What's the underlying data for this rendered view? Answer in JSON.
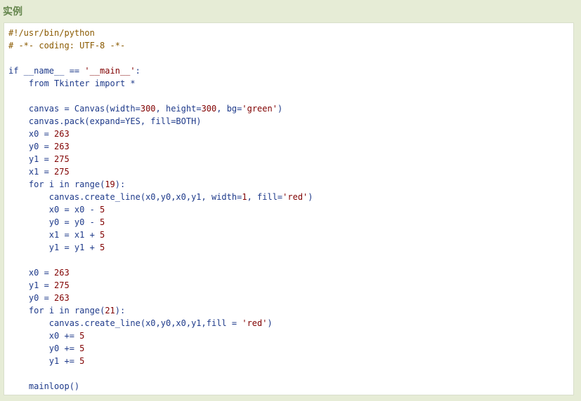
{
  "title": "实例",
  "colors": {
    "background": "#e6ecd6",
    "title": "#64854c",
    "code_box": "#ffffff",
    "code_border": "#d9dfcb",
    "comment": "#8a5a00",
    "keyword": "#1e3a8a",
    "identifier": "#1e3a8a",
    "number": "#800000",
    "string": "#800000"
  },
  "code_lines": [
    [
      {
        "t": "com",
        "v": "#!/usr/bin/python"
      }
    ],
    [
      {
        "t": "com",
        "v": "# -*- coding: UTF-8 -*-"
      }
    ],
    [],
    [
      {
        "t": "kw",
        "v": "if"
      },
      {
        "t": "plain",
        "v": " __name__ == "
      },
      {
        "t": "str",
        "v": "'__main__'"
      },
      {
        "t": "plain",
        "v": ":"
      }
    ],
    [
      {
        "t": "plain",
        "v": "    "
      },
      {
        "t": "kw",
        "v": "from"
      },
      {
        "t": "plain",
        "v": " Tkinter "
      },
      {
        "t": "kw",
        "v": "import"
      },
      {
        "t": "plain",
        "v": " *"
      }
    ],
    [],
    [
      {
        "t": "plain",
        "v": "    canvas = Canvas(width="
      },
      {
        "t": "num",
        "v": "300"
      },
      {
        "t": "plain",
        "v": ", height="
      },
      {
        "t": "num",
        "v": "300"
      },
      {
        "t": "plain",
        "v": ", bg="
      },
      {
        "t": "str",
        "v": "'green'"
      },
      {
        "t": "plain",
        "v": ")"
      }
    ],
    [
      {
        "t": "plain",
        "v": "    canvas.pack(expand=YES, fill=BOTH)"
      }
    ],
    [
      {
        "t": "plain",
        "v": "    x0 = "
      },
      {
        "t": "num",
        "v": "263"
      }
    ],
    [
      {
        "t": "plain",
        "v": "    y0 = "
      },
      {
        "t": "num",
        "v": "263"
      }
    ],
    [
      {
        "t": "plain",
        "v": "    y1 = "
      },
      {
        "t": "num",
        "v": "275"
      }
    ],
    [
      {
        "t": "plain",
        "v": "    x1 = "
      },
      {
        "t": "num",
        "v": "275"
      }
    ],
    [
      {
        "t": "plain",
        "v": "    "
      },
      {
        "t": "kw",
        "v": "for"
      },
      {
        "t": "plain",
        "v": " i "
      },
      {
        "t": "kw",
        "v": "in"
      },
      {
        "t": "plain",
        "v": " range("
      },
      {
        "t": "num",
        "v": "19"
      },
      {
        "t": "plain",
        "v": "):"
      }
    ],
    [
      {
        "t": "plain",
        "v": "        canvas.create_line(x0,y0,x0,y1, width="
      },
      {
        "t": "num",
        "v": "1"
      },
      {
        "t": "plain",
        "v": ", fill="
      },
      {
        "t": "str",
        "v": "'red'"
      },
      {
        "t": "plain",
        "v": ")"
      }
    ],
    [
      {
        "t": "plain",
        "v": "        x0 = x0 - "
      },
      {
        "t": "num",
        "v": "5"
      }
    ],
    [
      {
        "t": "plain",
        "v": "        y0 = y0 - "
      },
      {
        "t": "num",
        "v": "5"
      }
    ],
    [
      {
        "t": "plain",
        "v": "        x1 = x1 + "
      },
      {
        "t": "num",
        "v": "5"
      }
    ],
    [
      {
        "t": "plain",
        "v": "        y1 = y1 + "
      },
      {
        "t": "num",
        "v": "5"
      }
    ],
    [],
    [
      {
        "t": "plain",
        "v": "    x0 = "
      },
      {
        "t": "num",
        "v": "263"
      }
    ],
    [
      {
        "t": "plain",
        "v": "    y1 = "
      },
      {
        "t": "num",
        "v": "275"
      }
    ],
    [
      {
        "t": "plain",
        "v": "    y0 = "
      },
      {
        "t": "num",
        "v": "263"
      }
    ],
    [
      {
        "t": "plain",
        "v": "    "
      },
      {
        "t": "kw",
        "v": "for"
      },
      {
        "t": "plain",
        "v": " i "
      },
      {
        "t": "kw",
        "v": "in"
      },
      {
        "t": "plain",
        "v": " range("
      },
      {
        "t": "num",
        "v": "21"
      },
      {
        "t": "plain",
        "v": "):"
      }
    ],
    [
      {
        "t": "plain",
        "v": "        canvas.create_line(x0,y0,x0,y1,fill = "
      },
      {
        "t": "str",
        "v": "'red'"
      },
      {
        "t": "plain",
        "v": ")"
      }
    ],
    [
      {
        "t": "plain",
        "v": "        x0 += "
      },
      {
        "t": "num",
        "v": "5"
      }
    ],
    [
      {
        "t": "plain",
        "v": "        y0 += "
      },
      {
        "t": "num",
        "v": "5"
      }
    ],
    [
      {
        "t": "plain",
        "v": "        y1 += "
      },
      {
        "t": "num",
        "v": "5"
      }
    ],
    [],
    [
      {
        "t": "plain",
        "v": "    mainloop()"
      }
    ]
  ]
}
